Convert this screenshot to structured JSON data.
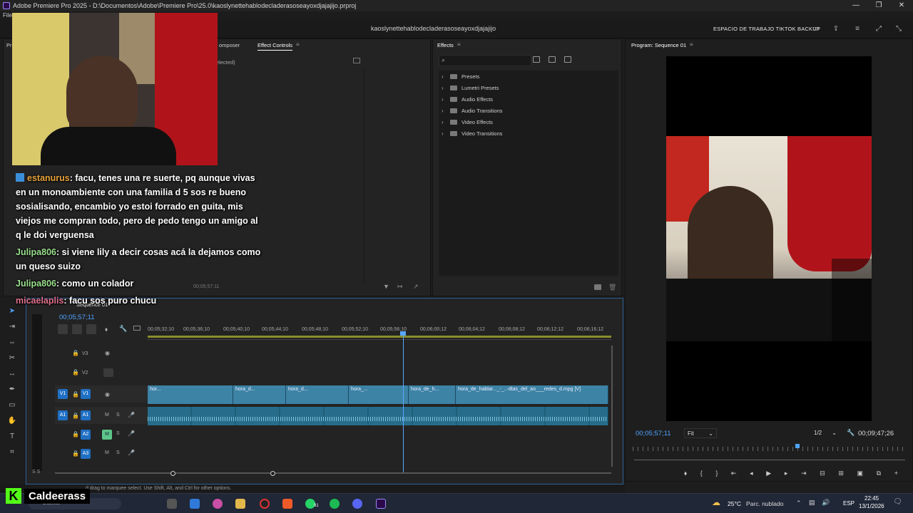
{
  "window": {
    "title": "Adobe Premiere Pro 2025 - D:\\Documentos\\Adobe\\Premiere Pro\\25.0\\kaoslynettehablodecladerasoseayoxdjajajijo.prproj",
    "minimize": "—",
    "maximize": "❐",
    "close": "✕"
  },
  "header": {
    "menu_first": "File",
    "project_name": "kaoslynettehablodecladerasoseayoxdjajajijo",
    "workspace_label": "ESPACIO DE TRABAJO TIKTOK BACKUP"
  },
  "source_panel": {
    "tab_partial": "Pr",
    "tab_composer": "omposer",
    "tab_effect_controls": "Effect Controls",
    "no_clip_label": "elected)",
    "timecode": "00;05;57;11"
  },
  "effects_panel": {
    "title": "Effects",
    "items": [
      {
        "label": "Presets"
      },
      {
        "label": "Lumetri Presets"
      },
      {
        "label": "Audio Effects"
      },
      {
        "label": "Audio Transitions"
      },
      {
        "label": "Video Effects"
      },
      {
        "label": "Video Transitions"
      }
    ]
  },
  "program_monitor": {
    "title": "Program: Sequence 01",
    "timecode_current": "00;05;57;11",
    "fit_label": "Fit",
    "resolution_label": "1/2",
    "timecode_duration": "00;09;47;26"
  },
  "timeline": {
    "tab_label": "Sequence 01",
    "timecode": "00;05;57;11",
    "ruler": [
      "00;05;32;10",
      "00;05;36;10",
      "00;05;40;10",
      "00;05;44;10",
      "00;05;48;10",
      "00;05;52;10",
      "00;05;56;10",
      "00;06;00;12",
      "00;06;04;12",
      "00;06;08;12",
      "00;06;12;12",
      "00;06;16;12"
    ],
    "tracks": [
      {
        "id": "V3",
        "type": "video"
      },
      {
        "id": "V2",
        "type": "video"
      },
      {
        "id": "V1",
        "type": "video",
        "source": "V1"
      },
      {
        "id": "A1",
        "type": "audio",
        "source": "A1",
        "m": "M",
        "s": "S"
      },
      {
        "id": "A2",
        "type": "audio",
        "m": "M",
        "s": "S"
      },
      {
        "id": "A3",
        "type": "audio",
        "m": "M",
        "s": "S"
      }
    ],
    "video_clips": [
      {
        "label": "hor..."
      },
      {
        "label": "hora_d..."
      },
      {
        "label": "hora_d..."
      },
      {
        "label": "hora_..."
      },
      {
        "label": "hora_de_h..."
      },
      {
        "label": "hora_de_hablar..._-_..-dtas_del_ao___redes_d.mpg [V]"
      }
    ],
    "meter_scale": "S S"
  },
  "status_bar": {
    "text": "d drag to marquee select. Use Shift, Alt, and Ctrl for other options."
  },
  "chat": {
    "messages": [
      {
        "user": "estanurus",
        "user_color": "#e8a33b",
        "text": ": facu, tenes una re suerte, pq aunque vivas en un monoambiente con una familia d 5 sos re bueno sosialisando, encambio yo estoi forrado en guita, mis viejos me compran todo, pero de pedo tengo un amigo al q le doi verguensa"
      },
      {
        "user": "Julipa806",
        "user_color": "#9be08e",
        "text": ": si viene lily a decir cosas acá la dejamos como un queso suizo"
      },
      {
        "user": "Julipa806",
        "user_color": "#9be08e",
        "text": ": como un colador"
      },
      {
        "user": "micaelaplis",
        "user_color": "#e0708c",
        "text": ": facu sos puro chucu"
      }
    ]
  },
  "brand": {
    "logo_letter": "K",
    "name": "Caldeerass"
  },
  "taskbar": {
    "search_partial": "Buscar",
    "whatsapp_badge": "91",
    "weather_temp": "25°C",
    "weather_text": "Parc. nublado",
    "language": "ESP",
    "time": "22:45",
    "date": "13/1/2026"
  },
  "colors": {
    "accent_blue": "#2e5f94",
    "clip_video": "#3d83a6",
    "clip_audio": "#276d8b",
    "playhead": "#5aa7ff",
    "track_target": "#1f6fc4",
    "mute_green": "#5dc58a"
  }
}
